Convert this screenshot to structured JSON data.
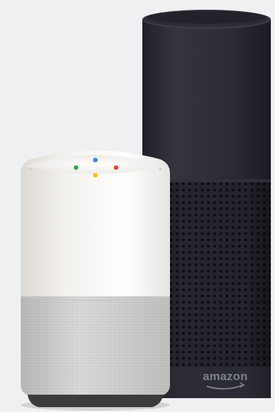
{
  "photo": {
    "background_color": "#eef0f2",
    "subjects": [
      {
        "id": "tall-speaker",
        "body_color": "#2b2c35",
        "logo": "amazon"
      },
      {
        "id": "short-speaker",
        "top_color": "#f1efeb",
        "fabric_color": "#d7d7d5",
        "base_color": "#3b3b3b"
      }
    ],
    "indicator_lights": [
      {
        "color": "#4285f4",
        "icon": "blue-light"
      },
      {
        "color": "#34a853",
        "icon": "green-light"
      },
      {
        "color": "#fbbc05",
        "icon": "yellow-light"
      },
      {
        "color": "#ea4335",
        "icon": "red-light"
      }
    ]
  },
  "brand": {
    "logo_text": "amazon"
  }
}
